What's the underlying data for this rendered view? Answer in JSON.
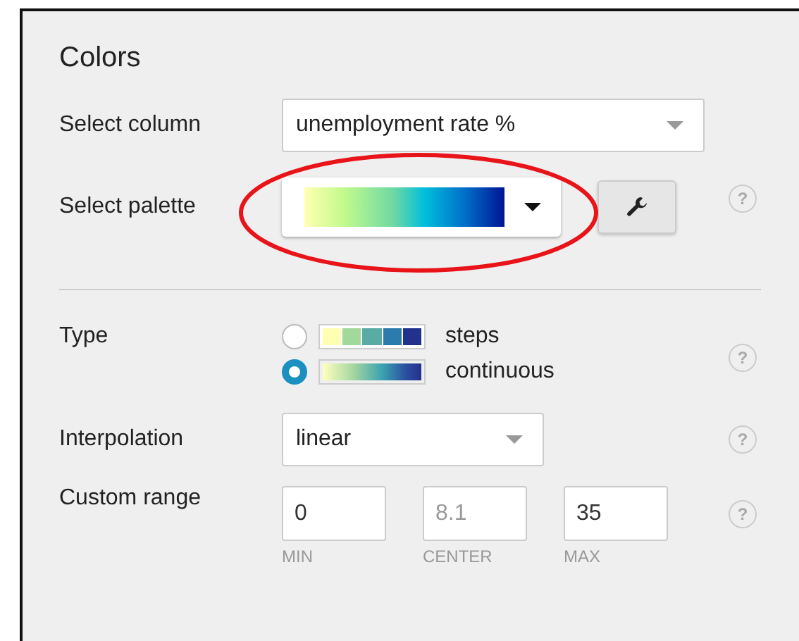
{
  "section": {
    "title": "Colors"
  },
  "select_column": {
    "label": "Select column",
    "value": "unemployment rate %"
  },
  "select_palette": {
    "label": "Select palette",
    "help": "?"
  },
  "type": {
    "label": "Type",
    "help": "?",
    "options": [
      {
        "label": "steps",
        "kind": "steps",
        "selected": false
      },
      {
        "label": "continuous",
        "kind": "continuous",
        "selected": true
      }
    ]
  },
  "interpolation": {
    "label": "Interpolation",
    "value": "linear",
    "help": "?"
  },
  "custom_range": {
    "label": "Custom range",
    "help": "?",
    "fields": [
      {
        "value": "0",
        "caption": "MIN"
      },
      {
        "placeholder": "8.1",
        "caption": "CENTER"
      },
      {
        "value": "35",
        "caption": "MAX"
      }
    ]
  }
}
